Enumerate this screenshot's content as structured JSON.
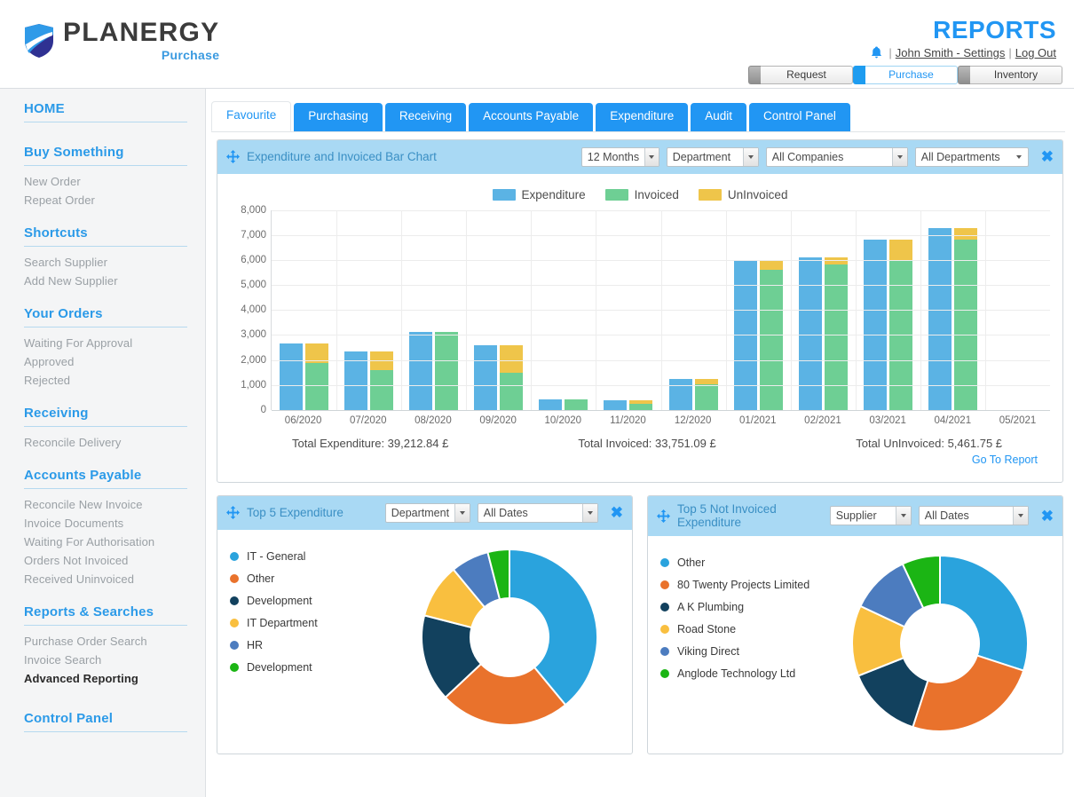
{
  "brand": {
    "name": "PLANERGY",
    "sub": "Purchase",
    "shield_icon": "shield-icon"
  },
  "header": {
    "page_title": "REPORTS",
    "bell_icon": "bell-icon",
    "user_label": "John Smith - Settings",
    "logout_label": "Log Out",
    "separator": "|",
    "modules": [
      {
        "label": "Request",
        "active": false
      },
      {
        "label": "Purchase",
        "active": true
      },
      {
        "label": "Inventory",
        "active": false
      }
    ]
  },
  "sidebar": {
    "groups": [
      {
        "title": "HOME",
        "items": []
      },
      {
        "title": "Buy Something",
        "items": [
          "New Order",
          "Repeat Order"
        ]
      },
      {
        "title": "Shortcuts",
        "items": [
          "Search Supplier",
          "Add New Supplier"
        ]
      },
      {
        "title": "Your Orders",
        "items": [
          "Waiting For Approval",
          "Approved",
          "Rejected"
        ]
      },
      {
        "title": "Receiving",
        "items": [
          "Reconcile Delivery"
        ]
      },
      {
        "title": "Accounts Payable",
        "items": [
          "Reconcile New Invoice",
          "Invoice Documents",
          "Waiting For Authorisation",
          "Orders Not Invoiced",
          "Received Uninvoiced"
        ]
      },
      {
        "title": "Reports & Searches",
        "items": [
          "Purchase Order Search",
          "Invoice Search",
          "Advanced Reporting"
        ],
        "active_item": "Advanced Reporting"
      },
      {
        "title": "Control Panel",
        "items": []
      }
    ]
  },
  "tabs": [
    {
      "label": "Favourite",
      "active": true
    },
    {
      "label": "Purchasing",
      "active": false
    },
    {
      "label": "Receiving",
      "active": false
    },
    {
      "label": "Accounts Payable",
      "active": false
    },
    {
      "label": "Expenditure",
      "active": false
    },
    {
      "label": "Audit",
      "active": false
    },
    {
      "label": "Control Panel",
      "active": false
    }
  ],
  "bar_widget": {
    "title": "Expenditure and Invoiced Bar Chart",
    "move_icon": "move-handle-icon",
    "close_icon": "close-icon",
    "filters": [
      {
        "name": "period",
        "value": "12 Months",
        "style": "button"
      },
      {
        "name": "group_by",
        "value": "Department",
        "style": "button"
      },
      {
        "name": "company",
        "value": "All Companies",
        "style": "button"
      },
      {
        "name": "department",
        "value": "All Departments",
        "style": "plain"
      }
    ],
    "totals": [
      "Total Expenditure: 39,212.84 £",
      "Total Invoiced: 33,751.09 £",
      "Total UnInvoiced: 5,461.75 £"
    ],
    "goto_label": "Go To Report"
  },
  "chart_data": {
    "type": "bar",
    "title": "Expenditure and Invoiced Bar Chart",
    "xlabel": "",
    "ylabel": "",
    "ylim": [
      0,
      8000
    ],
    "yticks": [
      "8,000",
      "7,000",
      "6,000",
      "5,000",
      "4,000",
      "3,000",
      "2,000",
      "1,000",
      "0"
    ],
    "ytick_values": [
      8000,
      7000,
      6000,
      5000,
      4000,
      3000,
      2000,
      1000,
      0
    ],
    "grid": true,
    "legend_position": "top-center",
    "categories": [
      "06/2020",
      "07/2020",
      "08/2020",
      "09/2020",
      "10/2020",
      "11/2020",
      "12/2020",
      "01/2021",
      "02/2021",
      "03/2021",
      "04/2021",
      "05/2021"
    ],
    "series": [
      {
        "name": "Expenditure",
        "color": "#5bb3e4",
        "values": [
          2650,
          2330,
          3120,
          2600,
          430,
          370,
          1230,
          6000,
          6120,
          6820,
          7300,
          0
        ]
      },
      {
        "name": "Invoiced",
        "color": "#6ecf94",
        "values": [
          1890,
          1580,
          3120,
          1500,
          430,
          230,
          1020,
          5630,
          5830,
          5960,
          6820,
          0
        ]
      },
      {
        "name": "UnInvoiced",
        "color": "#efc54a",
        "values": [
          760,
          750,
          0,
          1100,
          0,
          140,
          210,
          370,
          290,
          860,
          480,
          0
        ]
      }
    ],
    "stacking_note": "Invoiced and UnInvoiced are stacked in the second bar of each group"
  },
  "donut_left": {
    "title": "Top 5 Expenditure",
    "move_icon": "move-handle-icon",
    "close_icon": "close-icon",
    "filters": [
      {
        "name": "group_by",
        "value": "Department"
      },
      {
        "name": "dates",
        "value": "All Dates"
      }
    ],
    "chart": {
      "type": "pie",
      "title": "Top 5 Expenditure",
      "labels": [
        "IT - General",
        "Other",
        "Development",
        "IT Department",
        "HR",
        "Development"
      ],
      "values": [
        39,
        24,
        16,
        10,
        7,
        4
      ],
      "colors": [
        "#2aa3dd",
        "#e9722c",
        "#12415e",
        "#f9bf3f",
        "#4c7cbf",
        "#1bb514"
      ]
    }
  },
  "donut_right": {
    "title": "Top 5 Not Invoiced Expenditure",
    "move_icon": "move-handle-icon",
    "close_icon": "close-icon",
    "filters": [
      {
        "name": "group_by",
        "value": "Supplier"
      },
      {
        "name": "dates",
        "value": "All Dates"
      }
    ],
    "chart": {
      "type": "pie",
      "title": "Top 5 Not Invoiced Expenditure",
      "labels": [
        "Other",
        "80 Twenty Projects Limited",
        "A K Plumbing",
        "Road Stone",
        "Viking Direct",
        "Anglode Technology Ltd"
      ],
      "values": [
        30,
        25,
        14,
        13,
        11,
        7
      ],
      "colors": [
        "#2aa3dd",
        "#e9722c",
        "#12415e",
        "#f9bf3f",
        "#4c7cbf",
        "#1bb514"
      ]
    }
  },
  "colors": {
    "accent": "#2196f3",
    "widget_header": "#a9d9f4",
    "sidebar_bg": "#f4f5f6"
  }
}
